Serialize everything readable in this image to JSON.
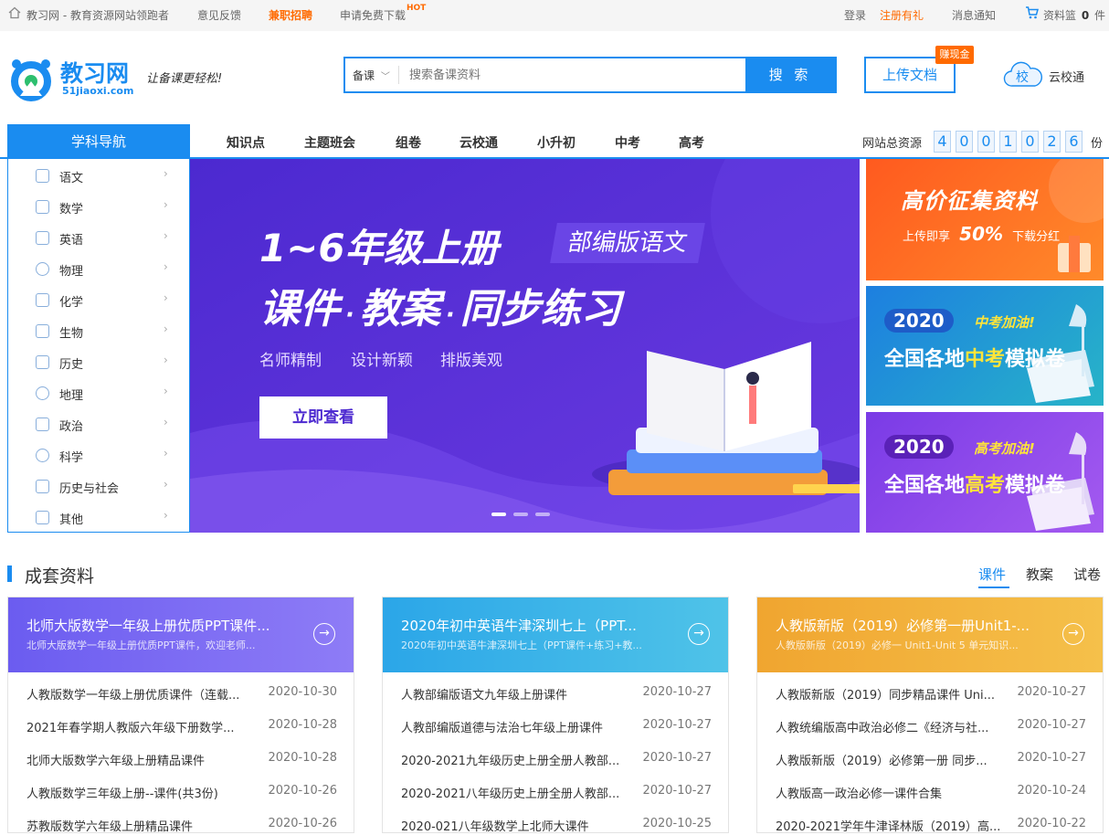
{
  "topbar": {
    "home_text": "教习网 - 教育资源网站领跑者",
    "feedback": "意见反馈",
    "jobs": "兼职招聘",
    "free_download": "申请免费下载",
    "hot": "HOT",
    "login": "登录",
    "register": "注册有礼",
    "messages": "消息通知",
    "basket_label": "资料篮",
    "basket_count": "0",
    "basket_unit": "件"
  },
  "header": {
    "logo_name": "教习网",
    "logo_domain": "51jiaoxi.com",
    "slogan": "让备课更轻松!",
    "search_select": "备课",
    "search_placeholder": "搜索备课资料",
    "search_button": "搜 索",
    "upload_button": "上传文档",
    "upload_badge": "赚现金",
    "cloud_icon_text": "校",
    "cloud_label": "云校通"
  },
  "nav": {
    "subject_nav": "学科导航",
    "items": [
      "知识点",
      "主题班会",
      "组卷",
      "云校通",
      "小升初",
      "中考",
      "高考"
    ],
    "total_label": "网站总资源",
    "total_digits": [
      "4",
      "0",
      "0",
      "1",
      "0",
      "2",
      "6"
    ],
    "total_unit": "份"
  },
  "subjects": [
    {
      "label": "语文",
      "icon": "book-icon"
    },
    {
      "label": "数学",
      "icon": "math-icon"
    },
    {
      "label": "英语",
      "icon": "english-icon"
    },
    {
      "label": "物理",
      "icon": "atom-icon"
    },
    {
      "label": "化学",
      "icon": "flask-icon"
    },
    {
      "label": "生物",
      "icon": "dna-icon"
    },
    {
      "label": "历史",
      "icon": "history-icon"
    },
    {
      "label": "地理",
      "icon": "globe-icon"
    },
    {
      "label": "政治",
      "icon": "politics-icon"
    },
    {
      "label": "科学",
      "icon": "bulb-icon"
    },
    {
      "label": "历史与社会",
      "icon": "society-icon"
    },
    {
      "label": "其他",
      "icon": "grid-icon"
    }
  ],
  "banner": {
    "headline": "1~6年级上册",
    "tag": "部编版语文",
    "line2_a": "课件",
    "line2_b": "教案",
    "line2_c": "同步练习",
    "features": [
      "名师精制",
      "设计新颖",
      "排版美观"
    ],
    "cta": "立即查看",
    "slide_active": 1,
    "slide_count": 3
  },
  "promos": [
    {
      "title": "高价征集资料",
      "sub_pre": "上传即享",
      "sub_big": "50%",
      "sub_post": "下载分红"
    },
    {
      "year": "2020",
      "slogan": "中考加油!",
      "line_pre": "全国各地",
      "line_hl": "中考",
      "line_post": "模拟卷"
    },
    {
      "year": "2020",
      "slogan": "高考加油!",
      "line_pre": "全国各地",
      "line_hl": "高考",
      "line_post": "模拟卷"
    }
  ],
  "section": {
    "title": "成套资料",
    "tabs": [
      "课件",
      "教案",
      "试卷"
    ],
    "active_tab": "课件"
  },
  "cards": [
    {
      "title": "北师大版数学一年级上册优质PPT课件...",
      "subtitle": "北师大版数学一年级上册优质PPT课件，欢迎老师...",
      "items": [
        {
          "title": "人教版数学一年级上册优质课件（连载...",
          "date": "2020-10-30"
        },
        {
          "title": "2021年春学期人教版六年级下册数学...",
          "date": "2020-10-28"
        },
        {
          "title": "北师大版数学六年级上册精品课件",
          "date": "2020-10-28"
        },
        {
          "title": "人教版数学三年级上册--课件(共3份)",
          "date": "2020-10-26"
        },
        {
          "title": "苏教版数学六年级上册精品课件",
          "date": "2020-10-26"
        }
      ]
    },
    {
      "title": "2020年初中英语牛津深圳七上（PPT...",
      "subtitle": "2020年初中英语牛津深圳七上（PPT课件+练习+教...",
      "items": [
        {
          "title": "人教部编版语文九年级上册课件",
          "date": "2020-10-27"
        },
        {
          "title": "人教部编版道德与法治七年级上册课件",
          "date": "2020-10-27"
        },
        {
          "title": "2020-2021九年级历史上册全册人教部...",
          "date": "2020-10-27"
        },
        {
          "title": "2020-2021八年级历史上册全册人教部...",
          "date": "2020-10-27"
        },
        {
          "title": "2020-021八年级数学上北师大课件",
          "date": "2020-10-25"
        }
      ]
    },
    {
      "title": "人教版新版（2019）必修第一册Unit1-...",
      "subtitle": "人教版新版（2019）必修一 Unit1-Unit 5 单元知识...",
      "items": [
        {
          "title": "人教版新版（2019）同步精品课件 Uni...",
          "date": "2020-10-27"
        },
        {
          "title": "人教统编版高中政治必修二《经济与社...",
          "date": "2020-10-27"
        },
        {
          "title": "人教版新版（2019）必修第一册 同步...",
          "date": "2020-10-27"
        },
        {
          "title": "人教版高一政治必修一课件合集",
          "date": "2020-10-24"
        },
        {
          "title": "2020-2021学年牛津译林版（2019）高...",
          "date": "2020-10-22"
        }
      ]
    }
  ],
  "colors": {
    "brand_blue": "#1a8cf0",
    "orange": "#ff6a00",
    "banner_purple": "#5a2fd6",
    "card1": "#7b6af2",
    "card2": "#38b4e6",
    "card3": "#f2b13a"
  }
}
